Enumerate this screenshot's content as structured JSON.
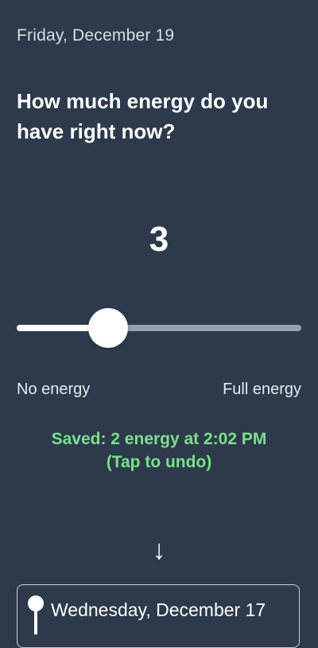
{
  "header": {
    "date": "Friday, December 19"
  },
  "prompt": {
    "question": "How much energy do you have right now?"
  },
  "energy": {
    "current_value": "3",
    "fraction": 0.32
  },
  "scale": {
    "min_label": "No energy",
    "max_label": "Full energy"
  },
  "status": {
    "saved_text": "Saved: 2 energy at 2:02 PM",
    "undo_text": "(Tap to undo)"
  },
  "history": {
    "arrow": "↓",
    "entry_date": "Wednesday, December 17"
  },
  "colors": {
    "background": "#2d3a4b",
    "accent_green": "#7be08d",
    "track": "#94a0ab"
  },
  "icons": {
    "pin": "pin-icon",
    "arrow": "arrow-down-icon"
  }
}
